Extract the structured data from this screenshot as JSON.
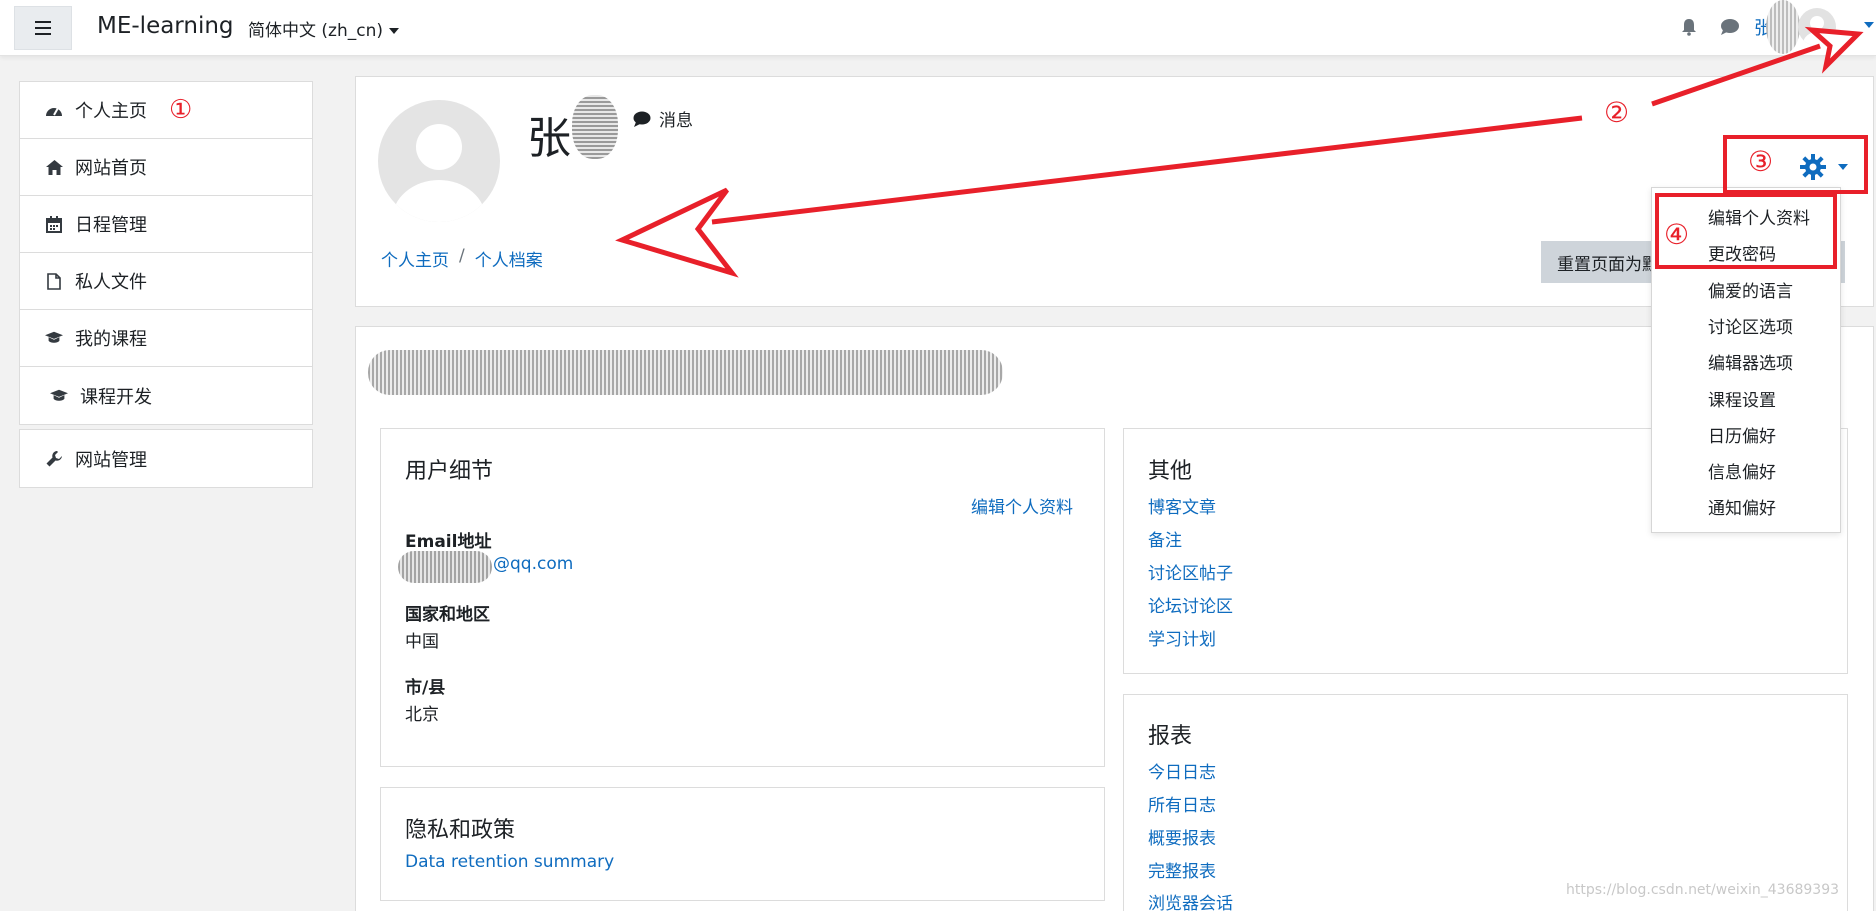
{
  "navbar": {
    "brand": "ME-learning",
    "language": "简体中文 (zh_cn)",
    "user_name": "张"
  },
  "sidebar": {
    "items": [
      {
        "label": "个人主页",
        "icon": "dashboard-icon"
      },
      {
        "label": "网站首页",
        "icon": "home-icon"
      },
      {
        "label": "日程管理",
        "icon": "calendar-icon"
      },
      {
        "label": "私人文件",
        "icon": "file-icon"
      },
      {
        "label": "我的课程",
        "icon": "graduation-cap-icon"
      },
      {
        "label": "课程开发",
        "icon": "graduation-cap-icon"
      }
    ],
    "admin": {
      "label": "网站管理",
      "icon": "wrench-icon"
    }
  },
  "profile": {
    "name": "张",
    "message_label": "消息",
    "breadcrumb": [
      "个人主页",
      "个人档案"
    ],
    "breadcrumb_sep": "/",
    "reset_button": "重置页面为默认"
  },
  "settings_menu": {
    "items": [
      "编辑个人资料",
      "更改密码",
      "偏爱的语言",
      "讨论区选项",
      "编辑器选项",
      "课程设置",
      "日历偏好",
      "信息偏好",
      "通知偏好"
    ]
  },
  "user_details": {
    "title": "用户细节",
    "edit_link": "编辑个人资料",
    "email_label": "Email地址",
    "email_value": "@qq.com",
    "country_label": "国家和地区",
    "country_value": "中国",
    "city_label": "市/县",
    "city_value": "北京"
  },
  "privacy": {
    "title": "隐私和政策",
    "link": "Data retention summary"
  },
  "misc": {
    "title": "其他",
    "links": [
      "博客文章",
      "备注",
      "讨论区帖子",
      "论坛讨论区",
      "学习计划"
    ]
  },
  "reports": {
    "title": "报表",
    "links": [
      "今日日志",
      "所有日志",
      "概要报表",
      "完整报表",
      "浏览器会话"
    ]
  },
  "annotations": {
    "markers": [
      "①",
      "②",
      "③",
      "④"
    ],
    "color": "#e8202a"
  },
  "watermark": "https://blog.csdn.net/weixin_43689393",
  "colors": {
    "link": "#0f6cbf",
    "text": "#1d2125",
    "background": "#f2f2f2"
  }
}
